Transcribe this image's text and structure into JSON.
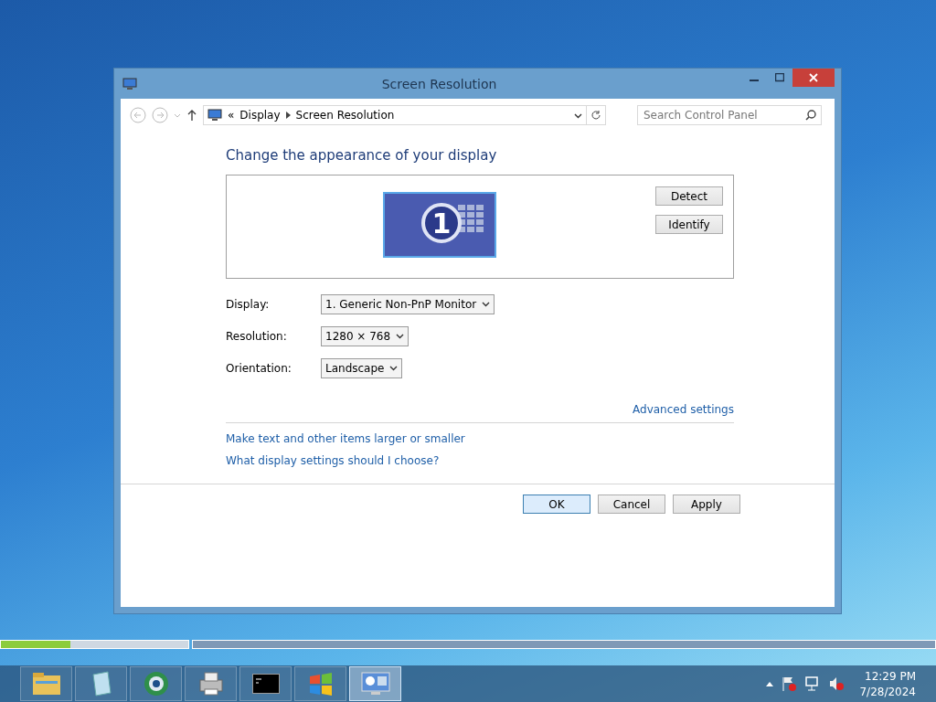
{
  "window": {
    "title": "Screen Resolution"
  },
  "address_bar": {
    "path_prefix": "«",
    "crumbs": [
      "Display",
      "Screen Resolution"
    ]
  },
  "search": {
    "placeholder": "Search Control Panel"
  },
  "heading": "Change the appearance of your display",
  "monitor_tile": {
    "number": "1"
  },
  "side_buttons": [
    "Detect",
    "Identify"
  ],
  "fields": [
    {
      "label": "Display:",
      "value": "1. Generic Non-PnP Monitor"
    },
    {
      "label": "Resolution:",
      "value": "1280 × 768"
    },
    {
      "label": "Orientation:",
      "value": "Landscape"
    }
  ],
  "advanced_link": "Advanced settings",
  "links": [
    "Make text and other items larger or smaller",
    "What display settings should I choose?"
  ],
  "buttons": [
    {
      "label": "OK",
      "selected": true
    },
    {
      "label": "Cancel",
      "selected": false
    },
    {
      "label": "Apply",
      "selected": false
    }
  ],
  "progress": {
    "level": 0.37
  },
  "taskbar": {
    "apps": [
      {
        "kind": "folder",
        "selected": false
      },
      {
        "kind": "notepad",
        "selected": false
      },
      {
        "kind": "globe",
        "selected": false
      },
      {
        "kind": "printer",
        "selected": false
      },
      {
        "kind": "console",
        "selected": false
      },
      {
        "kind": "windows",
        "selected": false
      },
      {
        "kind": "display",
        "selected": true
      }
    ],
    "time": "12:29 PM",
    "date": "7/28/2024"
  }
}
